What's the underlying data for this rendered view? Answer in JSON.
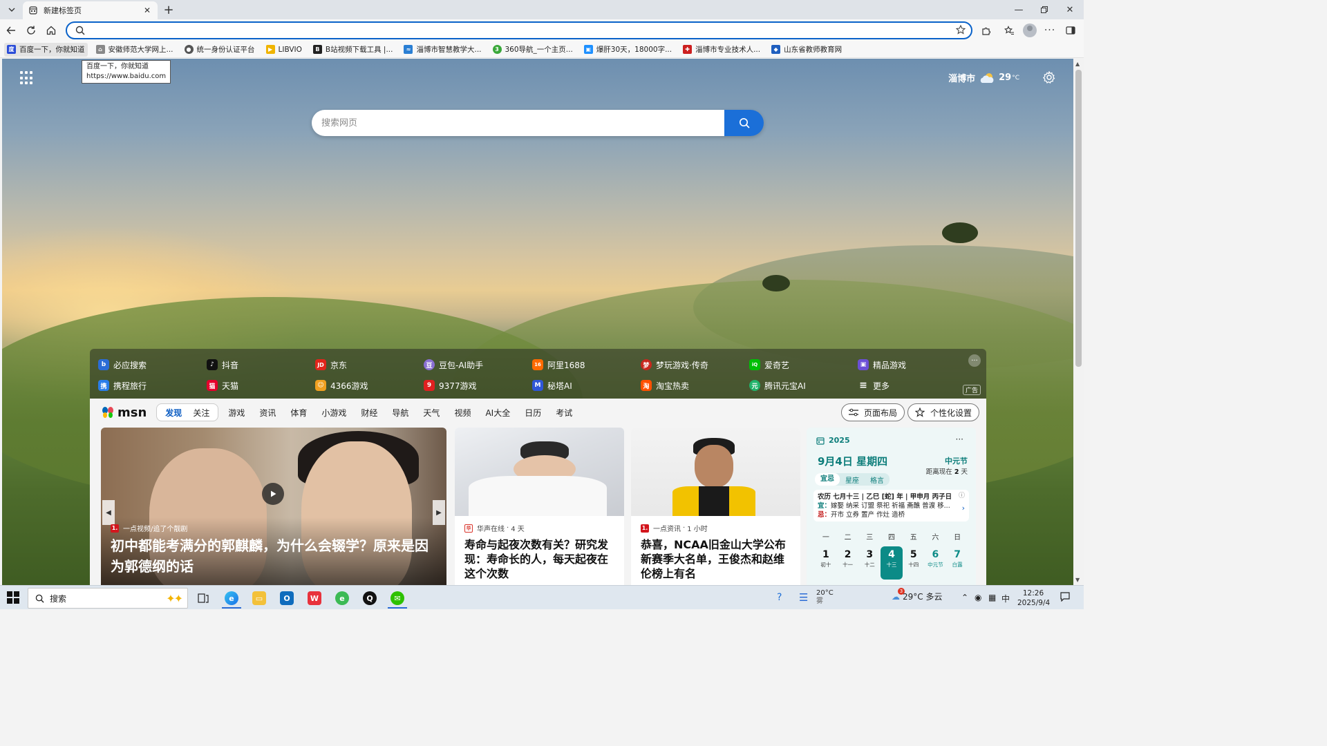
{
  "browser": {
    "tab_title": "新建标签页",
    "address_value": "",
    "bookmarks": [
      {
        "label": "百度一下，你就知道",
        "color": "#2a4cd8",
        "glyph": "度"
      },
      {
        "label": "安徽师范大学网上...",
        "color": "#888888",
        "glyph": "⌂"
      },
      {
        "label": "统一身份认证平台",
        "color": "#555555",
        "glyph": "●"
      },
      {
        "label": "LIBVIO",
        "color": "#f0b400",
        "glyph": "▶"
      },
      {
        "label": "B站视频下载工具 |...",
        "color": "#222222",
        "glyph": "B"
      },
      {
        "label": "淄博市智慧教学大...",
        "color": "#2a7fd4",
        "glyph": "≈"
      },
      {
        "label": "360导航_一个主页...",
        "color": "#3aa83a",
        "glyph": "3"
      },
      {
        "label": "爆肝30天，18000字...",
        "color": "#1e90ff",
        "glyph": "▣"
      },
      {
        "label": "淄博市专业技术人...",
        "color": "#cc1f1f",
        "glyph": "✚"
      },
      {
        "label": "山东省教师教育网",
        "color": "#1f5fbf",
        "glyph": "◆"
      }
    ],
    "tooltip": {
      "line1": "百度一下，你就知道",
      "line2": "https://www.baidu.com"
    }
  },
  "page": {
    "weather": {
      "city": "淄博市",
      "temp": "29",
      "unit": "°C"
    },
    "search_placeholder": "搜索网页",
    "quick_links": [
      {
        "label": "必应搜索",
        "color": "#2b6cd6",
        "glyph": "b"
      },
      {
        "label": "抖音",
        "color": "#111111",
        "glyph": "♪"
      },
      {
        "label": "京东",
        "color": "#e1251b",
        "glyph": "JD"
      },
      {
        "label": "豆包-AI助手",
        "color": "#8a6fd1",
        "glyph": "豆"
      },
      {
        "label": "阿里1688",
        "color": "#ff6a00",
        "glyph": "16"
      },
      {
        "label": "梦玩游戏·传奇",
        "color": "#c8281e",
        "glyph": "梦"
      },
      {
        "label": "爱奇艺",
        "color": "#00be06",
        "glyph": "iQ"
      },
      {
        "label": "精品游戏",
        "color": "#6b4fd6",
        "glyph": "▣"
      },
      {
        "label": "携程旅行",
        "color": "#2b7de9",
        "glyph": "携"
      },
      {
        "label": "天猫",
        "color": "#e4002b",
        "glyph": "猫"
      },
      {
        "label": "4366游戏",
        "color": "#f0a020",
        "glyph": "☺"
      },
      {
        "label": "9377游戏",
        "color": "#e02020",
        "glyph": "9"
      },
      {
        "label": "秘塔AI",
        "color": "#2f56d8",
        "glyph": "M"
      },
      {
        "label": "淘宝热卖",
        "color": "#ff5000",
        "glyph": "淘"
      },
      {
        "label": "腾讯元宝AI",
        "color": "#21b36b",
        "glyph": "元"
      },
      {
        "label": "更多",
        "color": "transparent",
        "glyph": "≡"
      }
    ],
    "ad_label": "广告"
  },
  "msn": {
    "logo": "msn",
    "segments": {
      "discover": "发现",
      "follow": "关注"
    },
    "nav": [
      "游戏",
      "资讯",
      "体育",
      "小游戏",
      "财经",
      "导航",
      "天气",
      "视频",
      "AI大全",
      "日历",
      "考试"
    ],
    "layout_btn": "页面布局",
    "personalize_btn": "个性化设置",
    "hero": {
      "source": "一点视频/追了个靓剧",
      "headline": "初中都能考满分的郭麒麟，为什么会辍学？原来是因为郭德纲的话"
    },
    "news": [
      {
        "source": "华声在线",
        "time": "4 天",
        "title": "寿命与起夜次数有关？研究发现：寿命长的人，每天起夜在这个次数",
        "badge": "华",
        "badge_color": "#d9342b"
      },
      {
        "source": "一点资讯",
        "time": "1 小时",
        "title": "恭喜，NCAA旧金山大学公布新赛季大名单，王俊杰和赵维伦榜上有名",
        "badge": "1.",
        "badge_color": "#d3161d"
      }
    ],
    "calendar": {
      "year": "2025",
      "date": "9月4日 星期四",
      "festival": "中元节",
      "distance_prefix": "距离现在",
      "distance_days": "2",
      "distance_unit": "天",
      "tabs": [
        "宜忌",
        "星座",
        "格言"
      ],
      "lunar": "农历 七月十三 | 乙巳 [蛇] 年 | 甲申月 丙子日",
      "yi_label": "宜：",
      "yi": "嫁娶 纳采 订盟 祭祀 祈福 斋醮 普渡 移...",
      "ji_label": "忌：",
      "ji": "开市 立券 置产 作灶 造桥",
      "weekdays": [
        "一",
        "二",
        "三",
        "四",
        "五",
        "六",
        "日"
      ],
      "days": [
        {
          "num": "1",
          "sub": "初十"
        },
        {
          "num": "2",
          "sub": "十一"
        },
        {
          "num": "3",
          "sub": "十二"
        },
        {
          "num": "4",
          "sub": "十三"
        },
        {
          "num": "5",
          "sub": "十四"
        },
        {
          "num": "6",
          "sub": "中元节"
        },
        {
          "num": "7",
          "sub": "白露"
        }
      ]
    }
  },
  "taskbar": {
    "search_label": "搜索",
    "weather_temp": "20°C",
    "weather_desc": "雾",
    "tray_weather": "29°C 多云",
    "tray_badge": "3",
    "ime": "中",
    "time": "12:26",
    "date": "2025/9/4"
  }
}
